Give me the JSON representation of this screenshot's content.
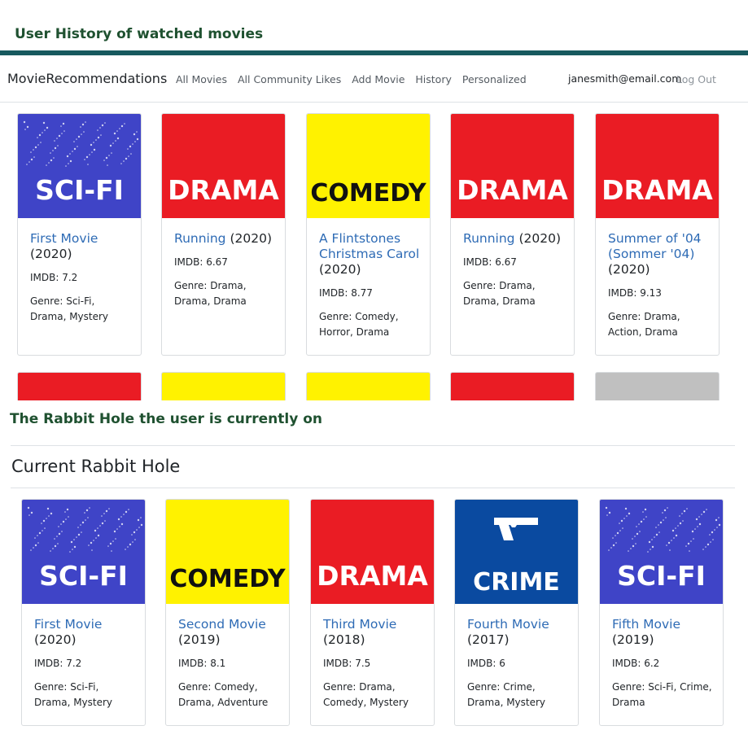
{
  "captions": {
    "top": "User History of watched movies",
    "middle": "The Rabbit Hole the user is currently on"
  },
  "navbar": {
    "brand": "MovieRecommendations",
    "links": [
      "All Movies",
      "All Community Likes",
      "Add Movie",
      "History",
      "Personalized"
    ],
    "email": "janesmith@email.com",
    "logout": "Log Out"
  },
  "colors": {
    "scifi": "#3f44c7",
    "drama": "#ea1c24",
    "comedy": "#fff200",
    "crime": "#0a4aa0",
    "gray": "#c0c0c0"
  },
  "history": [
    {
      "genre_label": "SCI-FI",
      "title": "First Movie",
      "year": "(2020)",
      "imdb": "IMDB: 7.2",
      "genres": "Genre: Sci-Fi, Drama, Mystery"
    },
    {
      "genre_label": "DRAMA",
      "title": "Running",
      "year": "(2020)",
      "imdb": "IMDB: 6.67",
      "genres": "Genre: Drama, Drama, Drama"
    },
    {
      "genre_label": "COMEDY",
      "title": "A Flintstones Christmas Carol",
      "year": "(2020)",
      "imdb": "IMDB: 8.77",
      "genres": "Genre: Comedy, Horror, Drama"
    },
    {
      "genre_label": "DRAMA",
      "title": "Running",
      "year": "(2020)",
      "imdb": "IMDB: 6.67",
      "genres": "Genre: Drama, Drama, Drama"
    },
    {
      "genre_label": "DRAMA",
      "title": "Summer of '04 (Sommer '04)",
      "year": "(2020)",
      "imdb": "IMDB: 9.13",
      "genres": "Genre: Drama, Action, Drama"
    }
  ],
  "section_title": "Current Rabbit Hole",
  "rabbit_hole": [
    {
      "genre_label": "SCI-FI",
      "title": "First Movie",
      "year": "(2020)",
      "imdb": "IMDB: 7.2",
      "genres": "Genre: Sci-Fi, Drama, Mystery"
    },
    {
      "genre_label": "COMEDY",
      "title": "Second Movie",
      "year": "(2019)",
      "imdb": "IMDB: 8.1",
      "genres": "Genre: Comedy, Drama, Adventure"
    },
    {
      "genre_label": "DRAMA",
      "title": "Third Movie",
      "year": "(2018)",
      "imdb": "IMDB: 7.5",
      "genres": "Genre: Drama, Comedy, Mystery"
    },
    {
      "genre_label": "CRIME",
      "title": "Fourth Movie",
      "year": "(2017)",
      "imdb": "IMDB: 6",
      "genres": "Genre: Crime, Drama, Mystery"
    },
    {
      "genre_label": "SCI-FI",
      "title": "Fifth Movie",
      "year": "(2019)",
      "imdb": "IMDB: 6.2",
      "genres": "Genre: Sci-Fi, Crime, Drama"
    }
  ]
}
